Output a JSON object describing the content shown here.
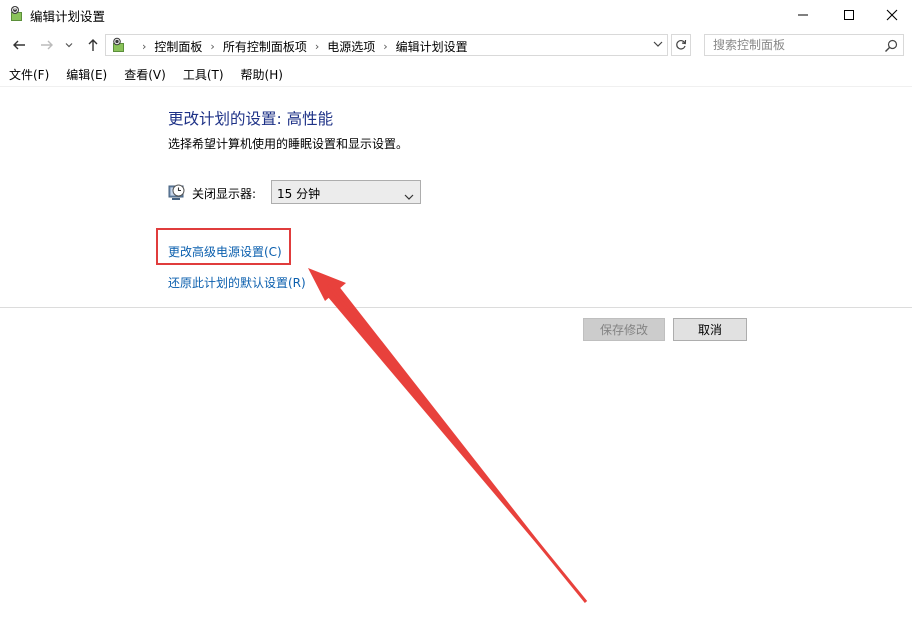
{
  "window": {
    "title": "编辑计划设置",
    "icon": "power-options-icon",
    "controls": {
      "minimize_icon": "minimize-icon",
      "maximize_icon": "maximize-icon",
      "close_icon": "close-icon"
    }
  },
  "nav": {
    "back_icon": "arrow-left-icon",
    "forward_icon": "arrow-right-icon",
    "recent_icon": "chevron-down-icon",
    "up_icon": "arrow-up-icon"
  },
  "address_bar": {
    "crumbs": [
      "控制面板",
      "所有控制面板项",
      "电源选项",
      "编辑计划设置"
    ],
    "separator": "›"
  },
  "search": {
    "placeholder": "搜索控制面板",
    "value": ""
  },
  "menu": [
    "文件(F)",
    "编辑(E)",
    "查看(V)",
    "工具(T)",
    "帮助(H)"
  ],
  "content": {
    "heading": "更改计划的设置: 高性能",
    "subheading": "选择希望计算机使用的睡眠设置和显示设置。",
    "display_off_label": "关闭显示器:",
    "display_off_value": "15 分钟",
    "advanced_link": "更改高级电源设置(C)",
    "restore_link": "还原此计划的默认设置(R)"
  },
  "buttons": {
    "save": "保存修改",
    "cancel": "取消"
  },
  "colors": {
    "heading": "#1e3287",
    "link": "#0b5fae",
    "annotation": "#e03c3c"
  }
}
